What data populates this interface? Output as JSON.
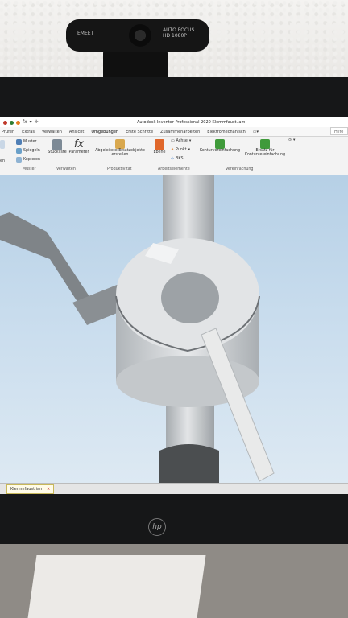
{
  "webcam": {
    "brand": "EMEET",
    "feature_line1": "AUTO FOCUS",
    "feature_line2": "HD 1080P"
  },
  "window": {
    "title": "Autodesk Inventor Professional 2020  Klemmfaust.iam",
    "help_search": "Hilfe und"
  },
  "quick_access": {
    "fx": "fx"
  },
  "menu": {
    "items": [
      "Prüfen",
      "Extras",
      "Verwalten",
      "Ansicht",
      "Umgebungen",
      "Erste Schritte",
      "Zusammenarbeiten",
      "Elektromechanisch"
    ]
  },
  "ribbon": {
    "muster": "Muster",
    "spiegeln": "Spiegeln",
    "kopieren": "Kopieren",
    "left_en": "en",
    "stueckliste": "Stückliste",
    "parameter": "Parameter",
    "abgeleitete": "Abgeleitete Ersatzobjekte erstellen",
    "ebene": "Ebene",
    "achse": "Achse",
    "punkt": "Punkt",
    "bks": "BKS",
    "konturvereinfachung": "Konturvereinfachung",
    "ersatz": "Ersatz für Konturvereinfachung",
    "groups": {
      "muster": "Muster",
      "verwalten": "Verwalten",
      "produktivitaet": "Produktivität",
      "arbeitselemente": "Arbeitselemente",
      "vereinfachung": "Vereinfachung"
    }
  },
  "document_tab": {
    "label": "Klemmfaust.iam",
    "close": "×"
  },
  "bezel": {
    "logo": "hp"
  },
  "colors": {
    "viewport_top": "#b6d0e6",
    "ribbon_bg": "#f3f3f3",
    "tab_bg": "#fffbe8"
  }
}
